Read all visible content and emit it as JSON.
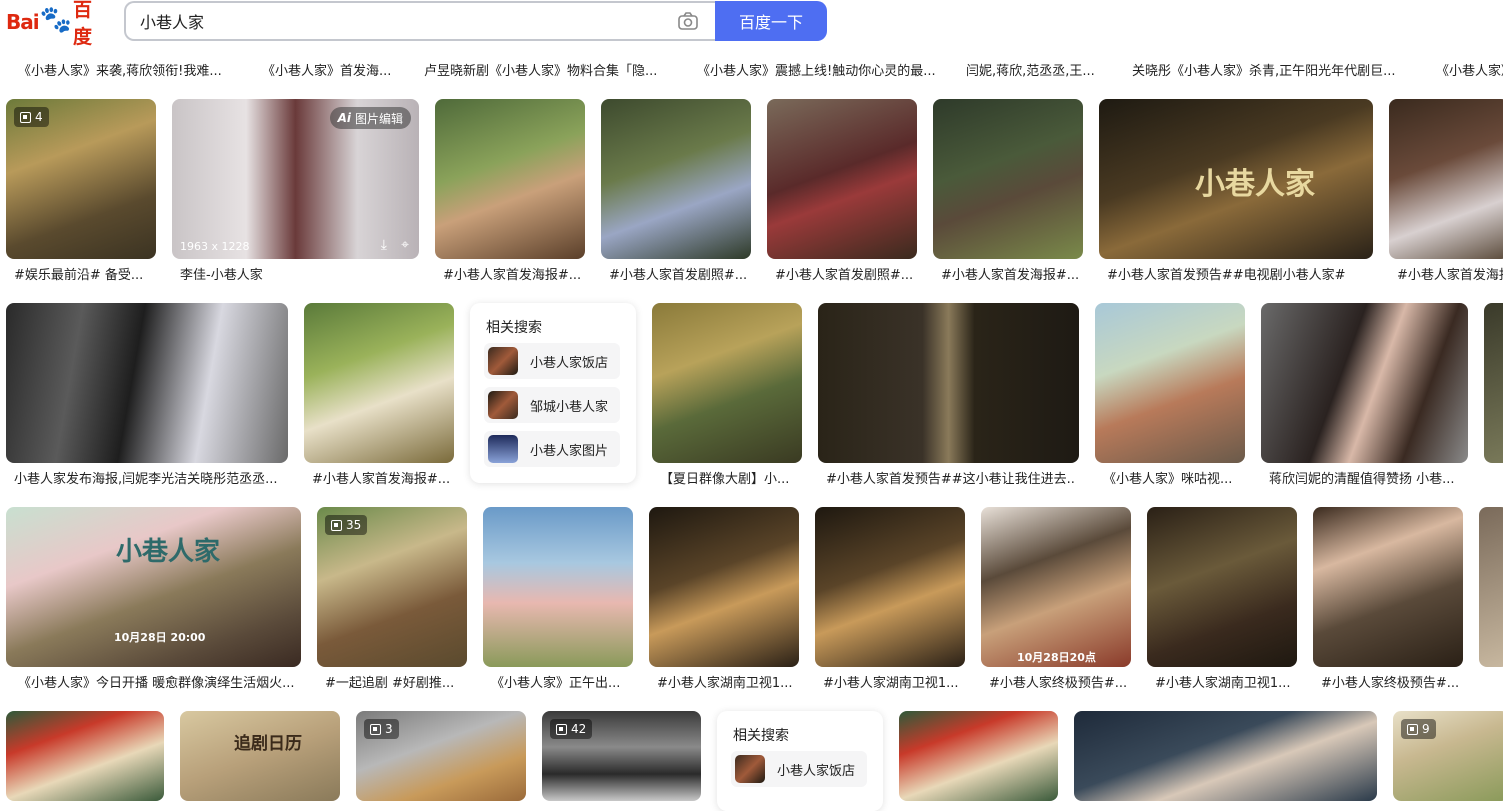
{
  "logo": {
    "bai": "Bai",
    "du": "du",
    "baidu_cn": "百度"
  },
  "search": {
    "query": "小巷人家",
    "button": "百度一下"
  },
  "colors": {
    "accent": "#4e6ef2",
    "logo_red": "#de2910",
    "logo_blue": "#2932e1"
  },
  "top_captions": [
    "《小巷人家》来袭,蒋欣领衔!我难...",
    "《小巷人家》首发海...",
    "卢昱晓新剧《小巷人家》物料合集「隐...",
    "《小巷人家》震撼上线!触动你心灵的最...",
    "闫妮,蒋欣,范丞丞,王...",
    "关晓彤《小巷人家》杀青,正午阳光年代剧巨...",
    "《小巷人家》"
  ],
  "row1": {
    "badge1": "4",
    "ai_edit": "图片编辑",
    "ai_prefix": "Ai",
    "dims": "1963 x 1228",
    "captions": [
      "#娱乐最前沿# 备受...",
      "李佳-小巷人家",
      "#小巷人家首发海报#...",
      "#小巷人家首发剧照#...",
      "#小巷人家首发剧照#...",
      "#小巷人家首发海报#...",
      "#小巷人家首发预告##电视剧小巷人家#",
      "#小巷人家首发海报"
    ]
  },
  "row2": {
    "captions": [
      "小巷人家发布海报,闫妮李光洁关晓彤范丞丞...",
      "#小巷人家首发海报#...",
      "【夏日群像大剧】小...",
      "#小巷人家首发预告##这小巷让我住进去...",
      "《小巷人家》咪咕视...",
      "蒋欣闫妮的清醒值得赞扬 小巷..."
    ]
  },
  "related1": {
    "title": "相关搜索",
    "items": [
      "小巷人家饭店",
      "邹城小巷人家",
      "小巷人家图片"
    ]
  },
  "row3": {
    "badge": "35",
    "poster_date": "10月28日 20:00",
    "poster_date2": "10月28日20点",
    "captions": [
      "《小巷人家》今日开播 暖愈群像演绎生活烟火...",
      "#一起追剧 #好剧推...",
      "《小巷人家》正午出...",
      "#小巷人家湖南卫视1...",
      "#小巷人家湖南卫视1...",
      "#小巷人家终极预告#...",
      "#小巷人家湖南卫视1...",
      "#小巷人家终极预告#..."
    ]
  },
  "row4": {
    "badges": [
      "3",
      "42",
      "9"
    ],
    "calendar_title": "追剧日历"
  },
  "related2": {
    "title": "相关搜索",
    "items": [
      "小巷人家饭店"
    ]
  },
  "title_art": "小巷人家"
}
